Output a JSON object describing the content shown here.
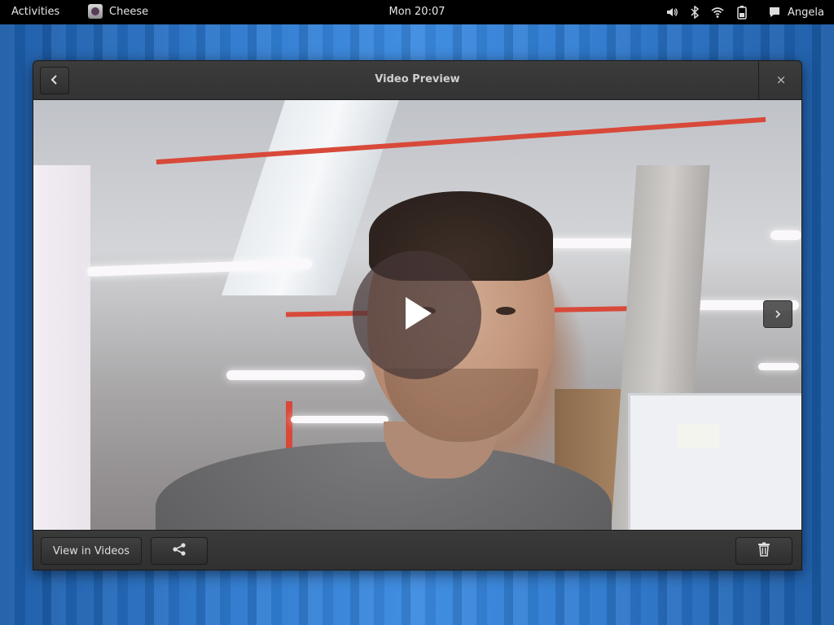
{
  "topbar": {
    "activities": "Activities",
    "app_name": "Cheese",
    "clock": "Mon 20:07",
    "user": "Angela",
    "icons": [
      "volume-icon",
      "bluetooth-icon",
      "wifi-icon",
      "battery-icon",
      "chat-icon"
    ]
  },
  "dialog": {
    "title": "Video Preview",
    "close_glyph": "×",
    "buttons": {
      "view_in_videos": "View in Videos"
    }
  },
  "colors": {
    "topbar_bg": "#000000",
    "dialog_bg": "#2d2d2d",
    "accent_red_pipe": "#d8493a",
    "wallpaper_blue": "#2f7bd0"
  }
}
